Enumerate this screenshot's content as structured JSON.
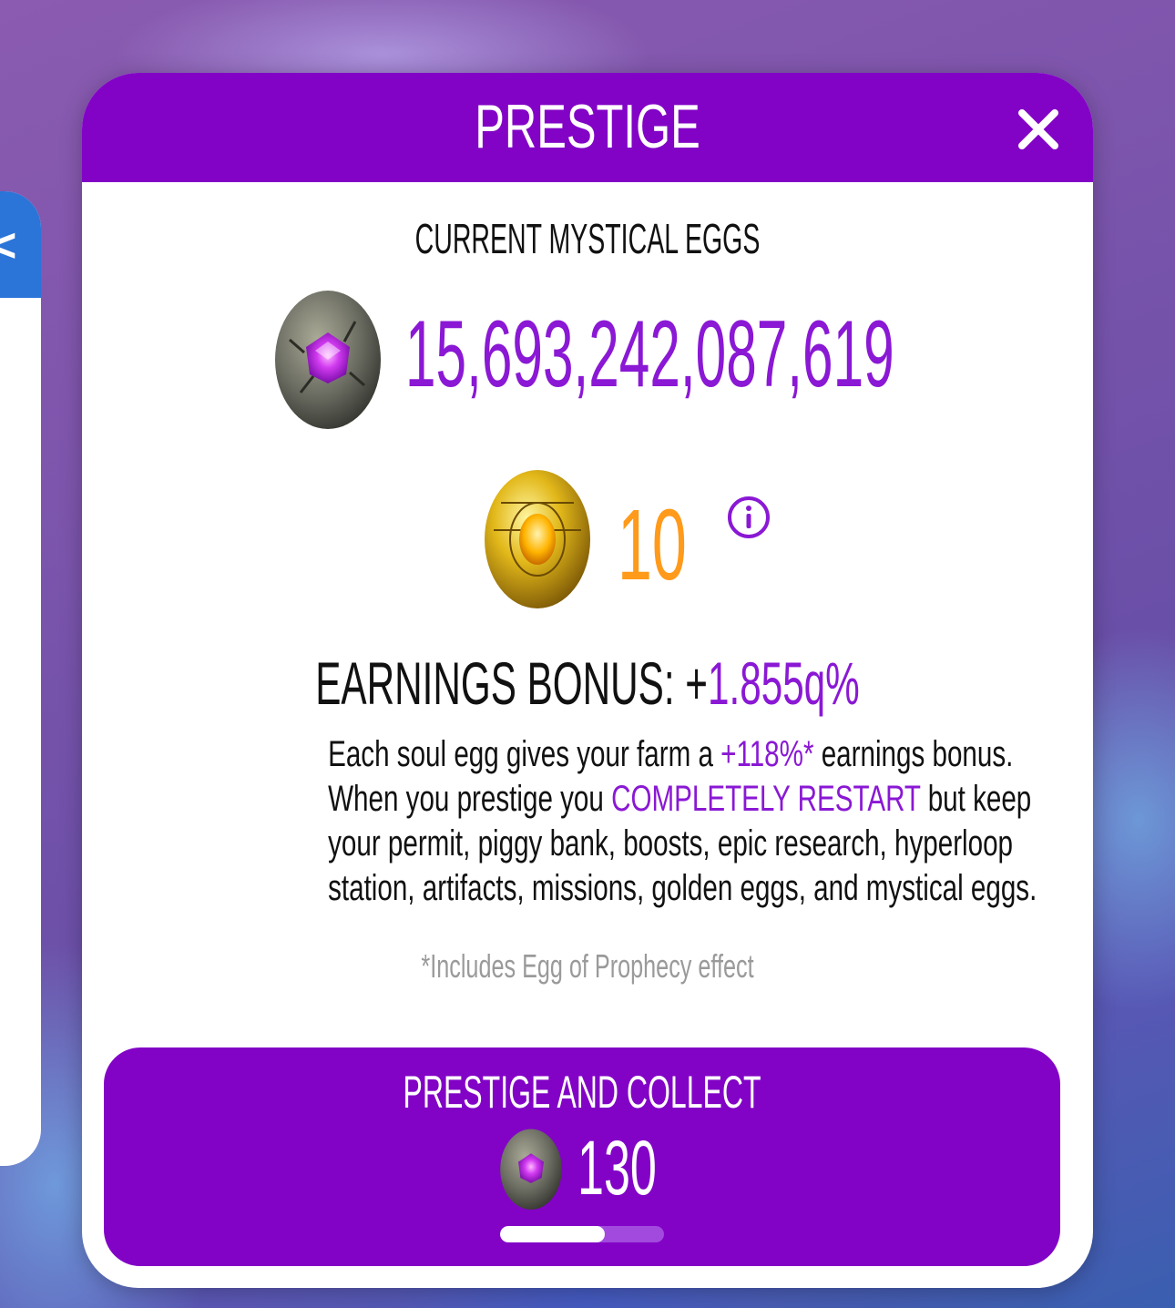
{
  "modal": {
    "title": "PRESTIGE",
    "current_label": "CURRENT MYSTICAL EGGS",
    "soul_eggs": "15,693,242,087,619",
    "golden_eggs": "10",
    "earnings_label": "EARNINGS BONUS: +",
    "earnings_value": "1.855q%",
    "description": {
      "l1_a": "Each soul egg gives your farm a ",
      "l1_hl": "+118%*",
      "l1_b": " earnings bonus.",
      "l2_a": "When you prestige you ",
      "l2_hl": "COMPLETELY RESTART",
      "l2_b": " but keep",
      "l3": "your permit, piggy bank, boosts, epic research, hyperloop",
      "l4": "station, artifacts, missions, golden eggs, and mystical eggs."
    },
    "footnote": "*Includes Egg of Prophecy effect",
    "collect_button": {
      "label": "PRESTIGE AND COLLECT",
      "amount": "130",
      "progress": 0.64
    }
  },
  "icons": {
    "close": "close-icon",
    "soul_egg": "soul-egg-icon",
    "golden_egg": "golden-egg-icon",
    "info": "info-icon"
  },
  "colors": {
    "accent": "#8203c6",
    "highlight": "#8a18d4",
    "golden": "#ff9a1a",
    "side_panel": "#2b74d8"
  }
}
